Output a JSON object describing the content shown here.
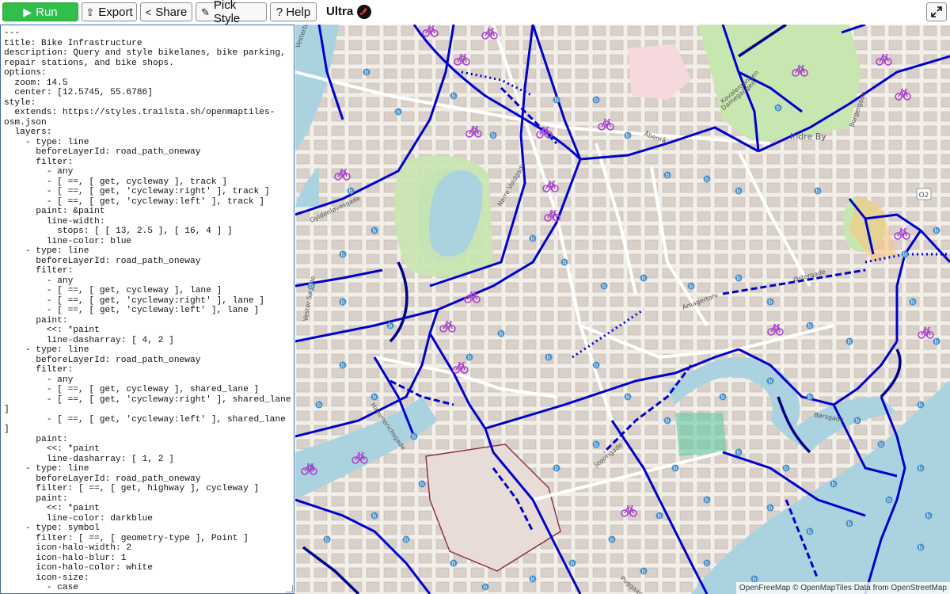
{
  "toolbar": {
    "run_label": "Run",
    "export_label": "Export",
    "share_label": "Share",
    "pick_style_label": "Pick Style",
    "help_label": "? Help",
    "ultra_label": "Ultra"
  },
  "icons": {
    "run": "play-icon",
    "export": "export-icon",
    "share": "share-icon",
    "pick_style": "brush-icon",
    "expand": "expand-icon",
    "bike_shop": "bicycle-icon",
    "bike_parking": "parking-icon"
  },
  "colors": {
    "run_button": "#2fbf4a",
    "bikelane": "#0000cc",
    "darkblue": "#00008b",
    "bike_icon": "#aa44cc",
    "water": "#aad3df",
    "park": "#c8e6b0"
  },
  "editor": {
    "code": "---\ntitle: Bike Infrastructure\ndescription: Query and style bikelanes, bike parking,\nrepair stations, and bike shops.\noptions:\n  zoom: 14.5\n  center: [12.5745, 55.6786]\nstyle:\n  extends: https://styles.trailsta.sh/openmaptiles-\nosm.json\n  layers:\n    - type: line\n      beforeLayerId: road_path_oneway\n      filter:\n        - any\n        - [ ==, [ get, cycleway ], track ]\n        - [ ==, [ get, 'cycleway:right' ], track ]\n        - [ ==, [ get, 'cycleway:left' ], track ]\n      paint: &paint\n        line-width:\n          stops: [ [ 13, 2.5 ], [ 16, 4 ] ]\n        line-color: blue\n    - type: line\n      beforeLayerId: road_path_oneway\n      filter:\n        - any\n        - [ ==, [ get, cycleway ], lane ]\n        - [ ==, [ get, 'cycleway:right' ], lane ]\n        - [ ==, [ get, 'cycleway:left' ], lane ]\n      paint:\n        <<: *paint\n        line-dasharray: [ 4, 2 ]\n    - type: line\n      beforeLayerId: road_path_oneway\n      filter:\n        - any\n        - [ ==, [ get, cycleway ], shared_lane ]\n        - [ ==, [ get, 'cycleway:right' ], shared_lane\n]\n        - [ ==, [ get, 'cycleway:left' ], shared_lane\n]\n      paint:\n        <<: *paint\n        line-dasharray: [ 1, 2 ]\n    - type: line\n      beforeLayerId: road_path_oneway\n      filter: [ ==, [ get, highway ], cycleway ]\n      paint:\n        <<: *paint\n        line-color: darkblue\n    - type: symbol\n      filter: [ ==, [ geometry-type ], Point ]\n      icon-halo-width: 2\n      icon-halo-blur: 1\n      icon-halo-color: white\n      icon-size:\n        - case"
  },
  "map": {
    "labels": {
      "indre_by": "Indre By",
      "kavalergangen": "Kavalergangen",
      "damegangen": "Damegangen",
      "amagertorv": "Amagertorv",
      "ostergade": "Østergade",
      "borgergade": "Borgergade",
      "abenra": "Åbenrå",
      "norrevoldgade": "Nørre Voldgade",
      "vestersogade": "Vester Søgade",
      "gyldenlovesgade": "Gyldenløvesgade",
      "hammerichsgade": "Hammerichsgade",
      "storm": "Stormgade",
      "puggaards": "Puggaardsgade",
      "borsgade": "Børsgade",
      "weidekampsgade": "Vesterbrogade",
      "o2": "O2"
    },
    "attribution": "OpenFreeMap © OpenMapTiles Data from OpenStreetMap"
  }
}
